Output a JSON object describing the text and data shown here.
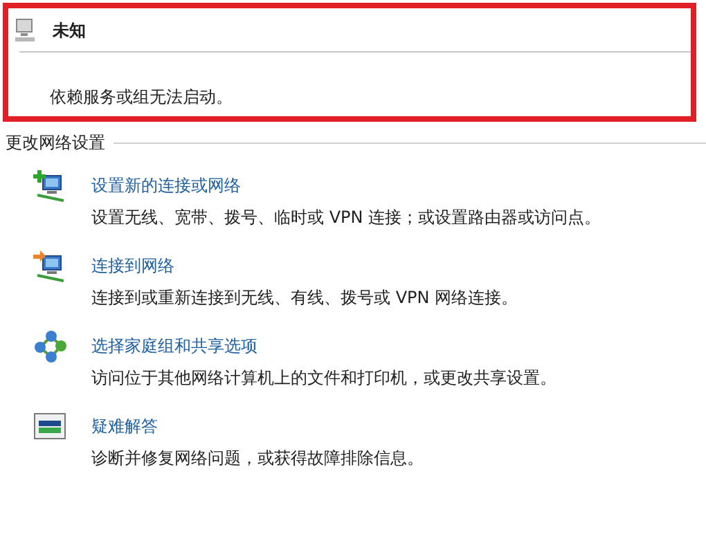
{
  "status": {
    "title": "未知",
    "message": "依赖服务或组无法启动。"
  },
  "section": {
    "heading": "更改网络设置"
  },
  "tasks": [
    {
      "kind": "new-connection",
      "link": "设置新的连接或网络",
      "description": "设置无线、宽带、拨号、临时或 VPN 连接；或设置路由器或访问点。"
    },
    {
      "kind": "connect",
      "link": "连接到网络",
      "description": "连接到或重新连接到无线、有线、拨号或 VPN 网络连接。"
    },
    {
      "kind": "homegroup",
      "link": "选择家庭组和共享选项",
      "description": "访问位于其他网络计算机上的文件和打印机，或更改共享设置。"
    },
    {
      "kind": "troubleshoot",
      "link": "疑难解答",
      "description": "诊断并修复网络问题，或获得故障排除信息。"
    }
  ]
}
